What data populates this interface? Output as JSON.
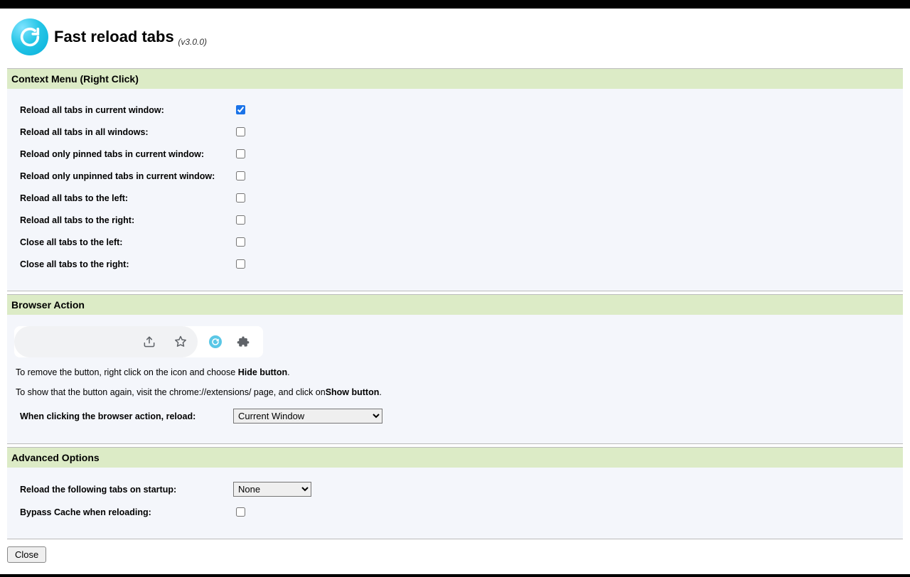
{
  "header": {
    "title": "Fast reload tabs",
    "version": "(v3.0.0)"
  },
  "sections": {
    "context": {
      "title": "Context Menu (Right Click)",
      "options": [
        {
          "label": "Reload all tabs in current window:",
          "checked": true
        },
        {
          "label": "Reload all tabs in all windows:",
          "checked": false
        },
        {
          "label": "Reload only pinned tabs in current window:",
          "checked": false
        },
        {
          "label": "Reload only unpinned tabs in current window:",
          "checked": false
        },
        {
          "label": "Reload all tabs to the left:",
          "checked": false
        },
        {
          "label": "Reload all tabs to the right:",
          "checked": false
        },
        {
          "label": "Close all tabs to the left:",
          "checked": false
        },
        {
          "label": "Close all tabs to the right:",
          "checked": false
        }
      ]
    },
    "browser_action": {
      "title": "Browser Action",
      "help1_pre": "To remove the button, right click on the icon and choose ",
      "help1_bold": "Hide button",
      "help1_post": ".",
      "help2_pre": "To show that the button again, visit the chrome://extensions/ page, and click on",
      "help2_bold": "Show button",
      "help2_post": ".",
      "when_click_label": "When clicking the browser action, reload:",
      "when_click_value": "Current Window"
    },
    "advanced": {
      "title": "Advanced Options",
      "startup_label": "Reload the following tabs on startup:",
      "startup_value": "None",
      "bypass_label": "Bypass Cache when reloading:",
      "bypass_checked": false
    }
  },
  "footer": {
    "close": "Close"
  }
}
